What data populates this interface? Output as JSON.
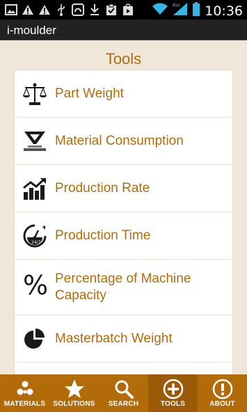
{
  "status_bar": {
    "time": "10:36",
    "icons": [
      "image-icon",
      "warning-icon",
      "warning-icon",
      "usb-icon",
      "app-icon",
      "download-icon",
      "clipboard-icon",
      "play-store-icon",
      "wifi-icon",
      "signal-icon",
      "battery-icon"
    ]
  },
  "app": {
    "title": "i-moulder"
  },
  "page": {
    "title": "Tools"
  },
  "tools": [
    {
      "label": "Part Weight",
      "icon": "balance-scale-icon"
    },
    {
      "label": "Material Consumption",
      "icon": "hopper-icon"
    },
    {
      "label": "Production Rate",
      "icon": "rising-chart-icon"
    },
    {
      "label": "Production Time",
      "icon": "timer-icon"
    },
    {
      "label": "Percentage of Machine Capacity",
      "icon": "percent-icon"
    },
    {
      "label": "Masterbatch Weight",
      "icon": "pie-chart-icon"
    }
  ],
  "bottom_nav": [
    {
      "label": "MATERIALS",
      "icon": "pellets-icon"
    },
    {
      "label": "SOLUTIONS",
      "icon": "star-icon"
    },
    {
      "label": "SEARCH",
      "icon": "search-icon"
    },
    {
      "label": "TOOLS",
      "icon": "plus-circle-icon",
      "active": true
    },
    {
      "label": "ABOUT",
      "icon": "info-icon"
    }
  ],
  "colors": {
    "accent": "#b36b0a",
    "background": "#efe7da",
    "nav_active": "#9a5a07"
  }
}
